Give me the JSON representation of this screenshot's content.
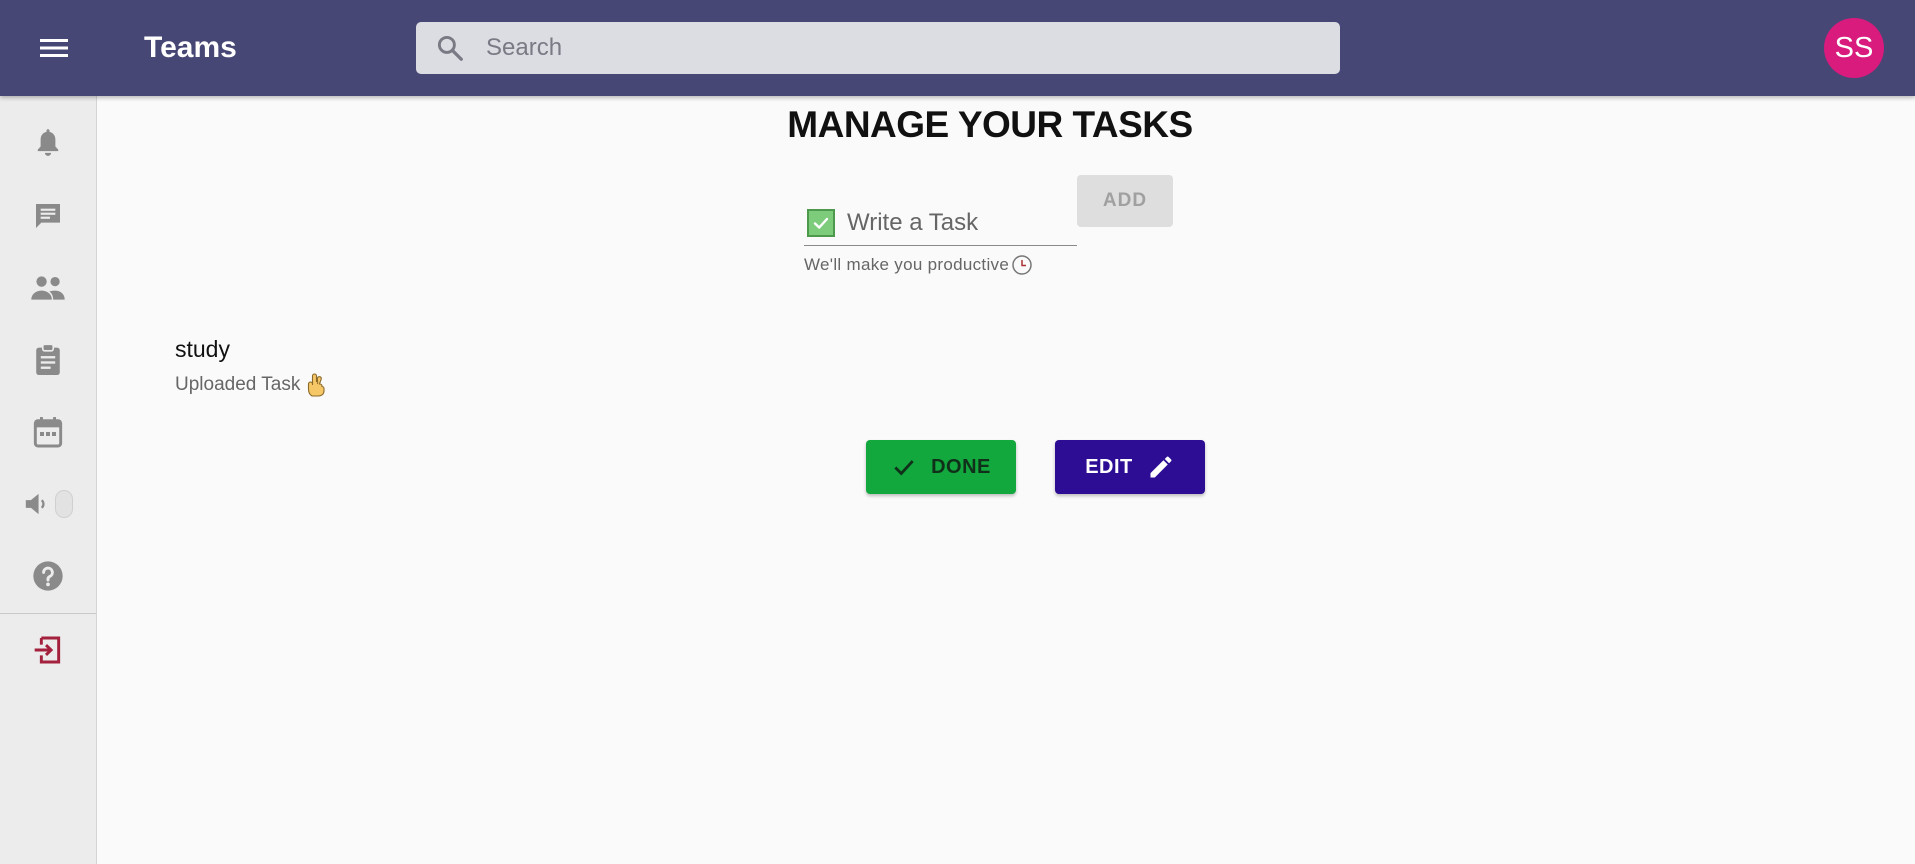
{
  "appbar": {
    "title": "Teams",
    "search_placeholder": "Search",
    "avatar_initials": "SS",
    "bar_color": "#474775",
    "avatar_color": "#d81b7d"
  },
  "sidebar": {
    "items": [
      {
        "icon": "bell-icon"
      },
      {
        "icon": "chat-icon"
      },
      {
        "icon": "people-icon"
      },
      {
        "icon": "clipboard-icon"
      },
      {
        "icon": "calendar-icon"
      },
      {
        "icon": "volume-icon"
      },
      {
        "icon": "help-icon"
      },
      {
        "icon": "logout-icon",
        "color": "#a3213d"
      }
    ]
  },
  "main": {
    "title": "MANAGE YOUR TASKS",
    "task_input_placeholder": "Write a Task",
    "helper_text": "We'll make you productive",
    "add_label": "ADD",
    "task": {
      "name": "study",
      "status": "Uploaded Task"
    },
    "done_label": "DONE",
    "edit_label": "EDIT",
    "done_color": "#12a83e",
    "edit_color": "#2c0d94"
  }
}
